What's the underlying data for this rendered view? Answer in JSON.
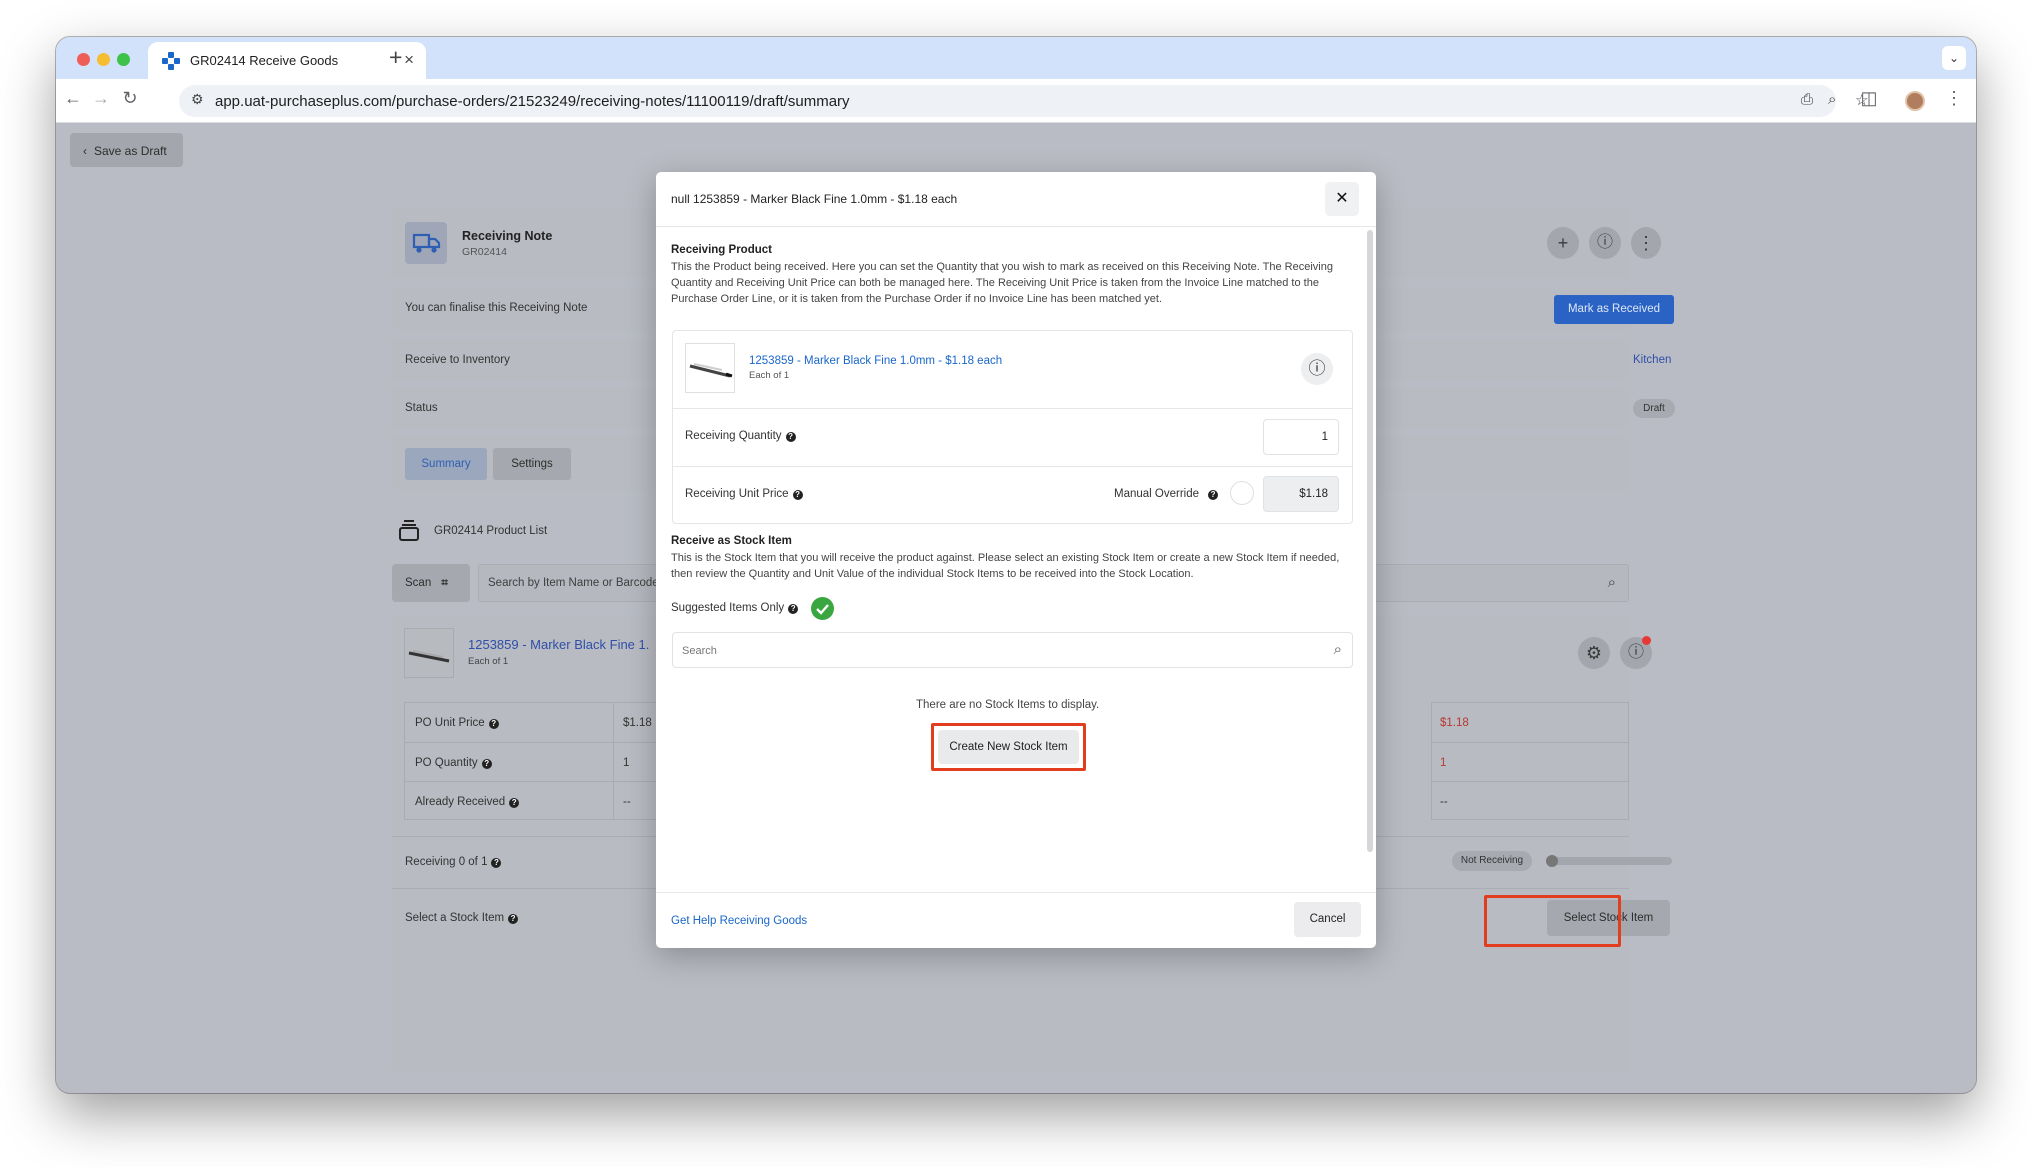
{
  "browser": {
    "tab_title": "GR02414 Receive Goods",
    "url": "app.uat-purchaseplus.com/purchase-orders/21523249/receiving-notes/11100119/draft/summary"
  },
  "page": {
    "save_draft_label": "Save as Draft",
    "header": {
      "title": "Receiving Note",
      "subtitle": "GR02414"
    },
    "finalise_text": "You can finalise this Receiving Note",
    "mark_received_label": "Mark as Received",
    "receive_inventory_label": "Receive to Inventory",
    "receive_inventory_value": "Kitchen",
    "status_label": "Status",
    "status_value": "Draft",
    "tabs": [
      "Summary",
      "Settings"
    ],
    "product_list_title": "GR02414 Product List",
    "scan_label": "Scan",
    "search_placeholder": "Search by Item Name or Barcode",
    "product": {
      "name": "1253859 - Marker Black Fine 1.",
      "unit": "Each of 1"
    },
    "table_labels": [
      "PO Unit Price",
      "PO Quantity",
      "Already Received"
    ],
    "table_values": [
      "$1.18",
      "1",
      "--"
    ],
    "table_right_values": [
      "$1.18",
      "1",
      "--"
    ],
    "receiving_label": "Receiving 0 of 1",
    "not_receiving_label": "Not Receiving",
    "receiving_progress": 0,
    "select_stock_label": "Select a Stock Item",
    "select_stock_button": "Select Stock Item"
  },
  "modal": {
    "title": "null 1253859 - Marker Black Fine 1.0mm - $1.18 each",
    "receiving_product_heading": "Receiving Product",
    "receiving_product_desc": "This the Product being received. Here you can set the Quantity that you wish to mark as received on this Receiving Note. The Receiving Quantity and Receiving Unit Price can both be managed here. The Receiving Unit Price is taken from the Invoice Line matched to the Purchase Order Line, or it is taken from the Purchase Order if no Invoice Line has been matched yet.",
    "product_name": "1253859 - Marker Black Fine 1.0mm - $1.18 each",
    "product_unit": "Each of 1",
    "qty_label": "Receiving Quantity",
    "qty_value": "1",
    "unit_price_label": "Receiving Unit Price",
    "manual_override_label": "Manual Override",
    "unit_price_value": "$1.18",
    "stock_heading": "Receive as Stock Item",
    "stock_desc": "This is the Stock Item that you will receive the product against. Please select an existing Stock Item or create a new Stock Item if needed, then review the Quantity and Unit Value of the individual Stock Items to be received into the Stock Location.",
    "suggested_label": "Suggested Items Only",
    "search_placeholder": "Search",
    "empty_text": "There are no Stock Items to display.",
    "create_button": "Create New Stock Item",
    "help_link": "Get Help Receiving Goods",
    "cancel_button": "Cancel"
  },
  "colors": {
    "primary": "#1a66c9",
    "highlight": "#e23d1f",
    "success": "#3aa640",
    "overlay": "#b9bcc4",
    "alert": "#e53935"
  }
}
